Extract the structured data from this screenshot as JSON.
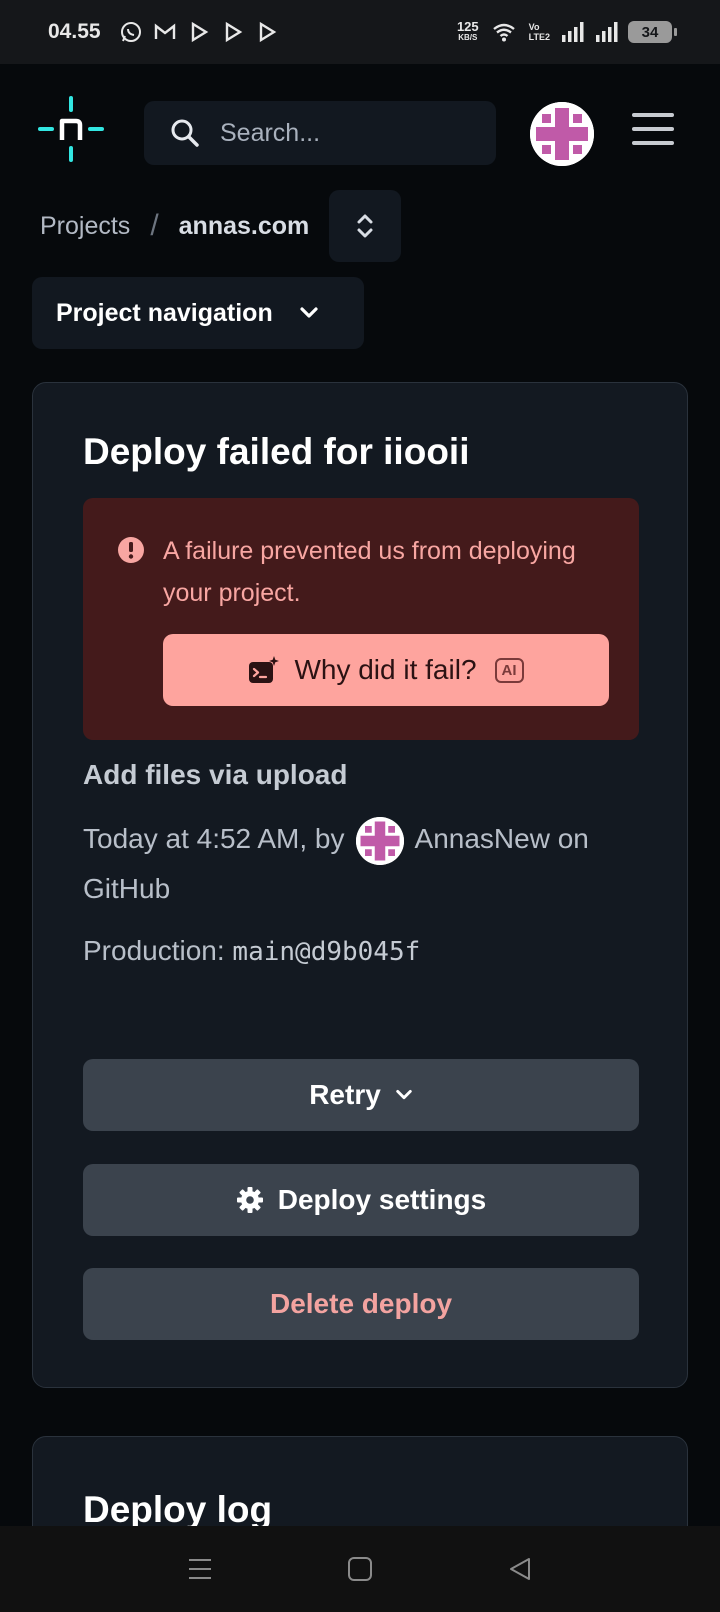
{
  "status_bar": {
    "time": "04.55",
    "net_speed_value": "125",
    "net_speed_unit": "KB/S",
    "volte_top": "Vo",
    "volte_bottom": "LTE2",
    "battery": "34",
    "notification_icons": [
      "whatsapp-icon",
      "gmail-icon",
      "play-icon",
      "play-icon",
      "play-icon"
    ]
  },
  "header": {
    "search_placeholder": "Search..."
  },
  "breadcrumb": {
    "root": "Projects",
    "separator": "/",
    "current": "annas.com"
  },
  "project_nav": {
    "label": "Project navigation"
  },
  "deploy": {
    "title": "Deploy failed for iiooii",
    "alert_text": "A failure prevented us from deploying your project.",
    "why_button": "Why did it fail?",
    "ai_badge": "AI",
    "commit_message": "Add files via upload",
    "meta_time": "Today at 4:52 AM, by",
    "meta_user": "AnnasNew",
    "meta_source": "on GitHub",
    "production_label": "Production:",
    "production_ref": "main@d9b045f",
    "retry_label": "Retry",
    "settings_label": "Deploy settings",
    "delete_label": "Delete deploy"
  },
  "deploy_log": {
    "title": "Deploy log"
  },
  "colors": {
    "accent_teal": "#32e6e2",
    "alert_bg": "#441a1b",
    "alert_text": "#f8a6a2",
    "why_button_bg": "#fea49e",
    "button_bg": "#3b434d",
    "avatar_magenta": "#c05aa8"
  }
}
